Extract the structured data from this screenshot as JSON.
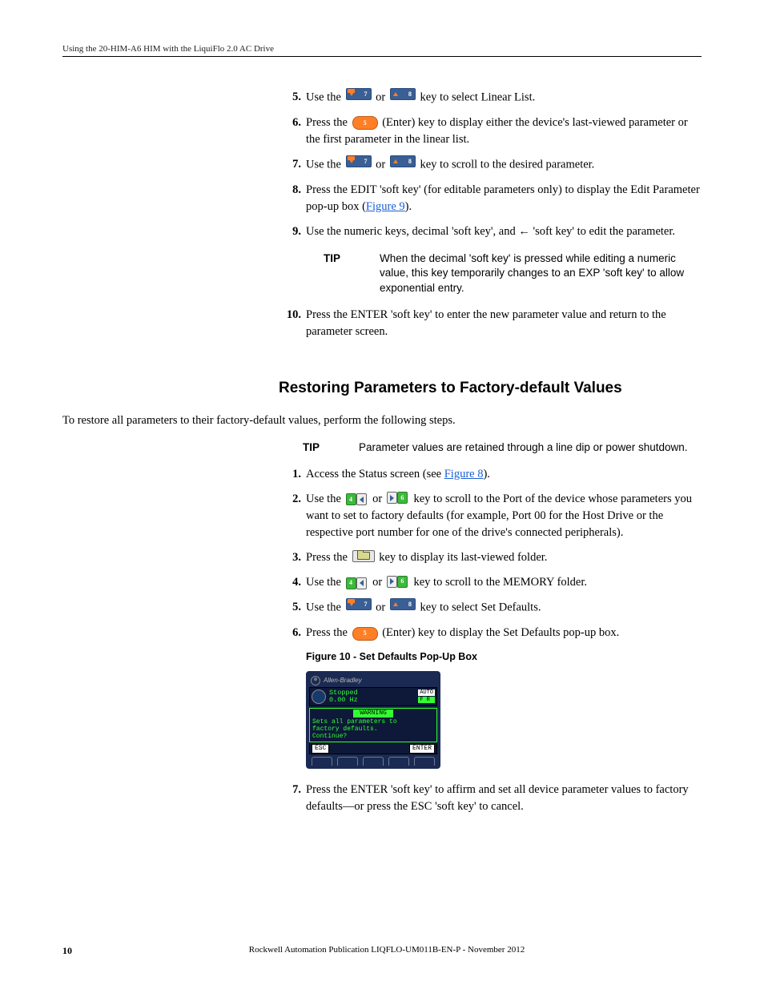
{
  "header": {
    "title": "Using the 20-HIM-A6 HIM with the LiquiFlo 2.0 AC Drive"
  },
  "steps_a": {
    "s5": {
      "num": "5.",
      "pre": "Use the ",
      "mid": " or ",
      "post": " key to select Linear List."
    },
    "s6": {
      "num": "6.",
      "pre": "Press the ",
      "post": " (Enter) key to display either the device's last-viewed parameter or the first parameter in the linear list."
    },
    "s7": {
      "num": "7.",
      "pre": "Use the ",
      "mid": " or ",
      "post": " key to scroll to the desired parameter."
    },
    "s8": {
      "num": "8.",
      "t1": "Press the EDIT 'soft key' (for editable parameters only) to display the Edit Parameter pop-up box (",
      "link": "Figure 9",
      "t2": ")."
    },
    "s9": {
      "num": "9.",
      "text": "Use the numeric keys, decimal 'soft key', and  ←  'soft key' to edit the parameter."
    },
    "s10": {
      "num": "10.",
      "text": "Press the ENTER 'soft key' to enter the new parameter value and return to the parameter screen."
    }
  },
  "tip1": {
    "label": "TIP",
    "text": "When the decimal 'soft key' is pressed while editing a numeric value, this key temporarily changes to an EXP 'soft key' to allow exponential entry."
  },
  "section": {
    "heading": "Restoring Parameters to Factory-default Values",
    "intro": "To restore all parameters to their factory-default values, perform the following steps."
  },
  "tip2": {
    "label": "TIP",
    "text": "Parameter values are retained through a line dip or power shutdown."
  },
  "steps_b": {
    "s1": {
      "num": "1.",
      "t1": "Access the Status screen (see ",
      "link": "Figure 8",
      "t2": ")."
    },
    "s2": {
      "num": "2.",
      "pre": "Use the ",
      "mid": " or ",
      "post": " key to scroll to the Port of the device whose parameters you want to set to factory defaults (for example, Port 00 for the Host Drive or the respective port number for one of the drive's connected peripherals)."
    },
    "s3": {
      "num": "3.",
      "pre": "Press the ",
      "post": " key to display its last-viewed folder."
    },
    "s4": {
      "num": "4.",
      "pre": "Use the ",
      "mid": " or ",
      "post": " key to scroll to the MEMORY folder."
    },
    "s5": {
      "num": "5.",
      "pre": "Use the ",
      "mid": " or ",
      "post": " key to select Set Defaults."
    },
    "s6": {
      "num": "6.",
      "pre": "Press the ",
      "post": " (Enter) key to display the Set Defaults pop-up box."
    },
    "s7": {
      "num": "7.",
      "text": "Press the ENTER 'soft key' to affirm and set all device parameter values to factory defaults—or press the ESC 'soft key' to cancel."
    }
  },
  "figure": {
    "caption": "Figure 10 - Set Defaults Pop-Up Box",
    "brand": "Allen-Bradley",
    "status_line1": "Stopped",
    "status_line2": "0.00 Hz",
    "badge_auto": "AUTO",
    "badge_fr": "F  R",
    "warn_title": "WARNING",
    "warn_text": "Sets all parameters to\nfactory defaults.\nContinue?",
    "soft_esc": "ESC",
    "soft_enter": "ENTER"
  },
  "keys": {
    "down_num": "7",
    "up_num": "8",
    "enter_num": "5",
    "left_num": "4",
    "right_num": "6"
  },
  "footer": {
    "page": "10",
    "pub": "Rockwell Automation Publication LIQFLO-UM011B-EN-P - November 2012"
  }
}
